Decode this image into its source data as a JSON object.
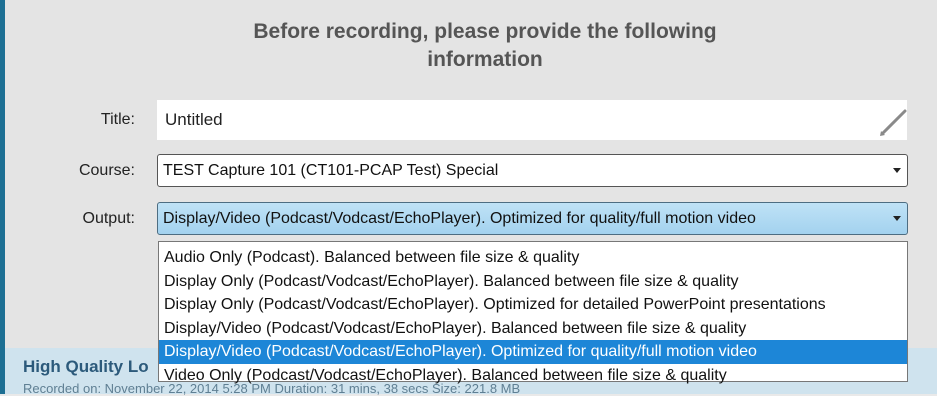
{
  "header": {
    "line1": "Before recording, please provide the following",
    "line2": "information"
  },
  "form": {
    "title_label": "Title:",
    "title_value": "Untitled",
    "course_label": "Course:",
    "course_value": "TEST Capture 101 (CT101-PCAP Test) Special",
    "output_label": "Output:",
    "output_value": "Display/Video (Podcast/Vodcast/EchoPlayer). Optimized for quality/full motion video"
  },
  "dropdown": {
    "options": [
      "Audio Only (Podcast). Balanced between file size & quality",
      "Display Only (Podcast/Vodcast/EchoPlayer). Balanced between file size & quality",
      "Display Only (Podcast/Vodcast/EchoPlayer). Optimized for detailed PowerPoint presentations",
      "Display/Video (Podcast/Vodcast/EchoPlayer). Balanced between file size & quality",
      "Display/Video (Podcast/Vodcast/EchoPlayer). Optimized for quality/full motion video",
      "Video Only (Podcast/Vodcast/EchoPlayer). Balanced between file size & quality"
    ],
    "selected_index": 4
  },
  "recording": {
    "title_partial": "High Quality Lo",
    "meta_partial": "Recorded on: November 22, 2014 5:28 PM     Duration: 31 mins, 38 secs     Size: 221.8 MB"
  },
  "colors": {
    "accent": "#1d86d7",
    "output_select_bg": "#bfe2f6",
    "left_strip": "#1d6f93"
  },
  "icons": {
    "edit": "pencil-icon",
    "dropdown": "chevron-down-icon"
  }
}
